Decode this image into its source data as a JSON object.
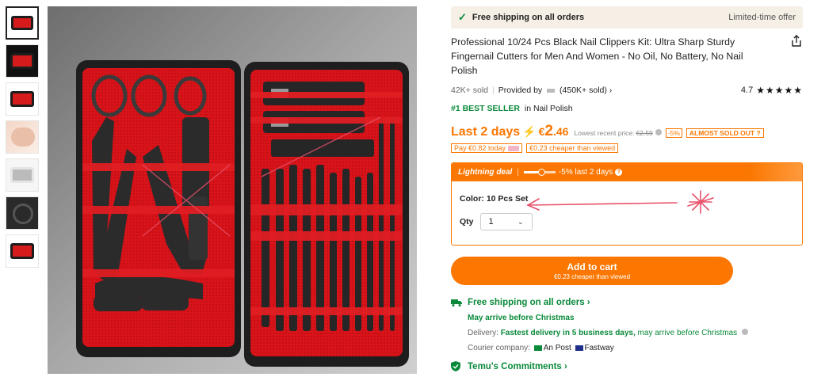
{
  "thumbnails": [
    "product-thumb-1",
    "product-thumb-2",
    "product-thumb-3",
    "product-thumb-4",
    "product-thumb-5",
    "product-thumb-6",
    "product-thumb-7"
  ],
  "banner": {
    "shipping": "Free shipping on all orders",
    "offer": "Limited-time offer"
  },
  "product": {
    "title": "Professional 10/24 Pcs Black Nail Clippers Kit: Ultra Sharp Sturdy Fingernail Cutters for Men And Women - No Oil, No Battery, No Nail Polish",
    "sold": "42K+ sold",
    "provided_by": "Provided by",
    "provider_sold": "(450K+ sold)",
    "rating": "4.7",
    "stars": "★★★★★",
    "best_seller_tag": "#1 BEST SELLER",
    "best_seller_category": "in Nail Polish"
  },
  "price": {
    "last_days": "Last 2 days",
    "currency": "€",
    "integer": "2",
    "decimal": ".46",
    "lowest_label": "Lowest recent price:",
    "lowest_value": "€2.59",
    "discount": "-5%",
    "stock_badge": "ALMOST SOLD OUT",
    "pay_text": "Pay €0.82 today",
    "cheaper_text": "€0.23 cheaper than viewed"
  },
  "deal": {
    "title": "Lightning deal",
    "progress": 0.55,
    "note": "-5% last 2 days",
    "color_label": "Color: 10 Pcs Set",
    "qty_label": "Qty",
    "qty_value": "1"
  },
  "cart": {
    "label": "Add to cart",
    "sub": "€0.23 cheaper than viewed"
  },
  "shipping": {
    "head": "Free shipping on all orders",
    "arrive": "May arrive before Christmas",
    "delivery_label": "Delivery:",
    "delivery_fast": "Fastest delivery in 5 business days,",
    "delivery_rest": "may arrive before Christmas",
    "courier_label": "Courier company:",
    "courier_1": "An Post",
    "courier_2": "Fastway"
  },
  "commitments": {
    "label": "Temu's Commitments"
  },
  "colors": {
    "accent": "#fb7701",
    "green": "#0a8a3a",
    "annotation": "#e8506a"
  }
}
